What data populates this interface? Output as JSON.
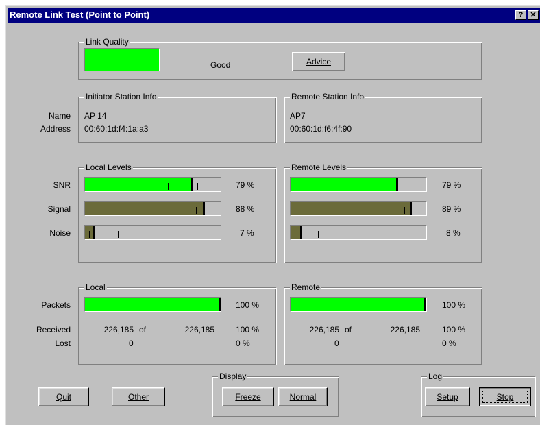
{
  "window": {
    "title": "Remote Link Test (Point to Point)",
    "help_glyph": "?",
    "close_glyph": "✕"
  },
  "link_quality": {
    "group_title": "Link Quality",
    "status": "Good",
    "color": "#00ff00",
    "advice_button": "Advice"
  },
  "station_labels": {
    "name": "Name",
    "address": "Address"
  },
  "initiator": {
    "group_title": "Initiator Station Info",
    "name": "AP 14",
    "address": "00:60:1d:f4:1a:a3"
  },
  "remote_station": {
    "group_title": "Remote Station Info",
    "name": "AP7",
    "address": "00:60:1d:f6:4f:90"
  },
  "level_labels": {
    "snr": "SNR",
    "signal": "Signal",
    "noise": "Noise"
  },
  "local_levels": {
    "group_title": "Local Levels",
    "snr": {
      "percent": 79,
      "display": "79 %",
      "fill_color": "#00ff00",
      "ticks": [
        61,
        83
      ]
    },
    "signal": {
      "percent": 88,
      "display": "88 %",
      "fill_color": "#6b6b3a",
      "ticks": [
        82,
        89
      ]
    },
    "noise": {
      "percent": 7,
      "display": "7 %",
      "fill_color": "#6b6b3a",
      "ticks": [
        3,
        24
      ]
    }
  },
  "remote_levels": {
    "group_title": "Remote Levels",
    "snr": {
      "percent": 79,
      "display": "79 %",
      "fill_color": "#00ff00",
      "ticks": [
        64,
        85
      ]
    },
    "signal": {
      "percent": 89,
      "display": "89 %",
      "fill_color": "#6b6b3a",
      "ticks": [
        84,
        88
      ]
    },
    "noise": {
      "percent": 8,
      "display": "8 %",
      "fill_color": "#6b6b3a",
      "ticks": [
        3,
        20
      ]
    }
  },
  "packet_labels": {
    "packets": "Packets",
    "received": "Received",
    "lost": "Lost",
    "of": "of"
  },
  "local_packets": {
    "group_title": "Local",
    "percent": 100,
    "display": "100 %",
    "received": "226,185",
    "total": "226,185",
    "received_pct": "100 %",
    "lost": "0",
    "lost_pct": "0 %"
  },
  "remote_packets": {
    "group_title": "Remote",
    "percent": 100,
    "display": "100 %",
    "received": "226,185",
    "total": "226,185",
    "received_pct": "100 %",
    "lost": "0",
    "lost_pct": "0 %"
  },
  "buttons": {
    "quit": "Quit",
    "other": "Other"
  },
  "display": {
    "group_title": "Display",
    "freeze": "Freeze",
    "normal": "Normal"
  },
  "log": {
    "group_title": "Log",
    "setup": "Setup",
    "stop": "Stop"
  }
}
